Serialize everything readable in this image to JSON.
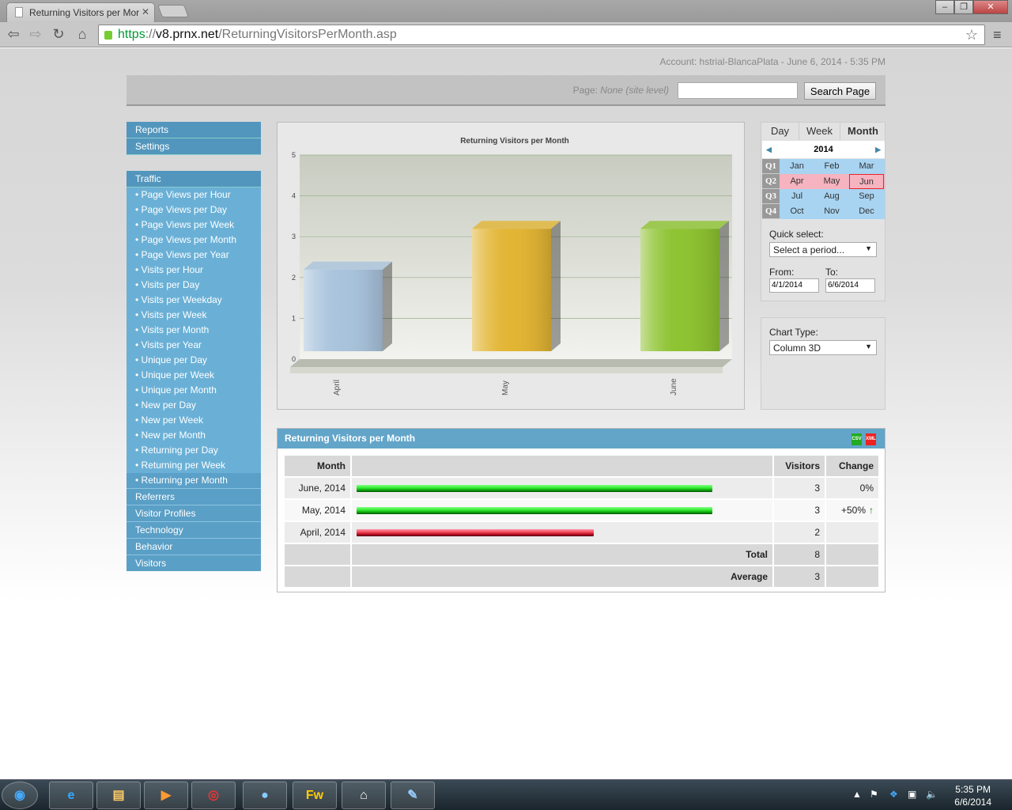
{
  "browser": {
    "tab_title": "Returning Visitors per Mor",
    "url_scheme": "https",
    "url_sep": "://",
    "url_host": "v8.prnx.net",
    "url_path": "/ReturningVisitorsPerMonth.asp"
  },
  "header": {
    "account": "Account: hstrial-BlancaPlata - June 6, 2014 - 5:35 PM",
    "page_label": "Page: ",
    "page_value": "None (site level)",
    "search_value": "",
    "search_button": "Search Page"
  },
  "sidebar": {
    "top": [
      {
        "label": "Reports"
      },
      {
        "label": "Settings"
      }
    ],
    "traffic_title": "Traffic",
    "traffic": [
      {
        "label": "• Page Views per Hour"
      },
      {
        "label": "• Page Views per Day"
      },
      {
        "label": "• Page Views per Week"
      },
      {
        "label": "• Page Views per Month"
      },
      {
        "label": "• Page Views per Year"
      },
      {
        "label": "• Visits per Hour"
      },
      {
        "label": "• Visits per Day"
      },
      {
        "label": "• Visits per Weekday"
      },
      {
        "label": "• Visits per Week"
      },
      {
        "label": "• Visits per Month"
      },
      {
        "label": "• Visits per Year"
      },
      {
        "label": "• Unique per Day"
      },
      {
        "label": "• Unique per Week"
      },
      {
        "label": "• Unique per Month"
      },
      {
        "label": "• New per Day"
      },
      {
        "label": "• New per Week"
      },
      {
        "label": "• New per Month"
      },
      {
        "label": "• Returning per Day"
      },
      {
        "label": "• Returning per Week"
      },
      {
        "label": "• Returning per Month"
      }
    ],
    "sections": [
      {
        "label": "Referrers"
      },
      {
        "label": "Visitor Profiles"
      },
      {
        "label": "Technology"
      },
      {
        "label": "Behavior"
      },
      {
        "label": "Visitors"
      }
    ]
  },
  "calendar": {
    "tabs": [
      "Day",
      "Week",
      "Month"
    ],
    "active_tab": "Month",
    "year": "2014",
    "quarters": [
      {
        "label": "Q1",
        "months": [
          "Jan",
          "Feb",
          "Mar"
        ]
      },
      {
        "label": "Q2",
        "months": [
          "Apr",
          "May",
          "Jun"
        ]
      },
      {
        "label": "Q3",
        "months": [
          "Jul",
          "Aug",
          "Sep"
        ]
      },
      {
        "label": "Q4",
        "months": [
          "Oct",
          "Nov",
          "Dec"
        ]
      }
    ],
    "selected_quarter": "Q2",
    "current_month": "Jun",
    "quick_select_label": "Quick select:",
    "quick_select_value": "Select a period...",
    "from_label": "From:",
    "from_value": "4/1/2014",
    "to_label": "To:",
    "to_value": "6/6/2014",
    "chart_type_label": "Chart Type:",
    "chart_type_value": "Column 3D"
  },
  "chart_data": {
    "type": "bar",
    "title": "Returning Visitors per Month",
    "categories": [
      "April",
      "May",
      "June"
    ],
    "values": [
      2,
      3,
      3
    ],
    "ylim": [
      0,
      5
    ],
    "yticks": [
      "0",
      "1",
      "2",
      "3",
      "4",
      "5"
    ],
    "grid": true,
    "colors": [
      "#a9c3dc",
      "#e2b534",
      "#8ec332"
    ]
  },
  "table": {
    "title": "Returning Visitors per Month",
    "export": [
      "CSV",
      "XML"
    ],
    "headers": {
      "month": "Month",
      "visitors": "Visitors",
      "change": "Change"
    },
    "rows": [
      {
        "month": "June, 2014",
        "visitors": "3",
        "change": "0%",
        "fraction": 1,
        "color": "green"
      },
      {
        "month": "May, 2014",
        "visitors": "3",
        "change": "+50%",
        "fraction": 1,
        "color": "green",
        "trend": "up"
      },
      {
        "month": "April, 2014",
        "visitors": "2",
        "change": "",
        "fraction": 0.667,
        "color": "red"
      }
    ],
    "total_label": "Total",
    "total": "8",
    "average_label": "Average",
    "average": "3"
  },
  "taskbar": {
    "time": "5:35 PM",
    "date": "6/6/2014",
    "apps": [
      "start",
      "internet-explorer",
      "file-explorer",
      "media-player",
      "chrome",
      "app-cat",
      "fireworks",
      "app-red",
      "paint"
    ]
  }
}
